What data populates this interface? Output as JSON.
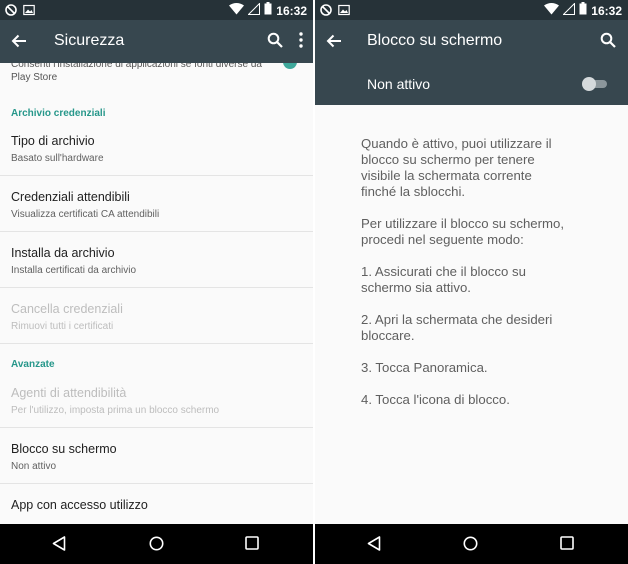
{
  "left": {
    "status": {
      "time": "16:32"
    },
    "appbar": {
      "title": "Sicurezza"
    },
    "peek": {
      "text": "Consenti l'installazione di applicazioni se fonti diverse da Play Store"
    },
    "sections": [
      {
        "title": "Archivio credenziali",
        "items": [
          {
            "primary": "Tipo di archivio",
            "secondary": "Basato sull'hardware",
            "enabled": true
          },
          {
            "primary": "Credenziali attendibili",
            "secondary": "Visualizza certificati CA attendibili",
            "enabled": true
          },
          {
            "primary": "Installa da archivio",
            "secondary": "Installa certificati da archivio",
            "enabled": true
          },
          {
            "primary": "Cancella credenziali",
            "secondary": "Rimuovi tutti i certificati",
            "enabled": false
          }
        ]
      },
      {
        "title": "Avanzate",
        "items": [
          {
            "primary": "Agenti di attendibilità",
            "secondary": "Per l'utilizzo, imposta prima un blocco schermo",
            "enabled": false
          },
          {
            "primary": "Blocco su schermo",
            "secondary": "Non attivo",
            "enabled": true
          },
          {
            "primary": "App con accesso utilizzo",
            "secondary": "",
            "enabled": true
          }
        ]
      }
    ]
  },
  "right": {
    "status": {
      "time": "16:32"
    },
    "appbar": {
      "title": "Blocco su schermo"
    },
    "switch": {
      "label": "Non attivo",
      "on": false
    },
    "paragraphs": [
      "Quando è attivo, puoi utilizzare il\nblocco su schermo per tenere\nvisibile la schermata corrente\nfinché la sblocchi.",
      "Per utilizzare il blocco su schermo,\nprocedi nel seguente modo:",
      "1. Assicurati che il blocco su\nschermo sia attivo.",
      "2. Apri la schermata che desideri\nbloccare.",
      "3. Tocca Panoramica.",
      "4. Tocca l'icona di blocco."
    ]
  },
  "icons": {
    "status_left": [
      "dnd-icon",
      "image-notification-icon"
    ],
    "status_right": [
      "wifi-icon",
      "signal-icon",
      "battery-icon"
    ],
    "nav": [
      "back-nav-icon",
      "home-nav-icon",
      "recents-nav-icon"
    ]
  },
  "colors": {
    "status_bar": "#263238",
    "app_bar": "#37474f",
    "accent": "#26978a",
    "nav_bar": "#000000"
  }
}
